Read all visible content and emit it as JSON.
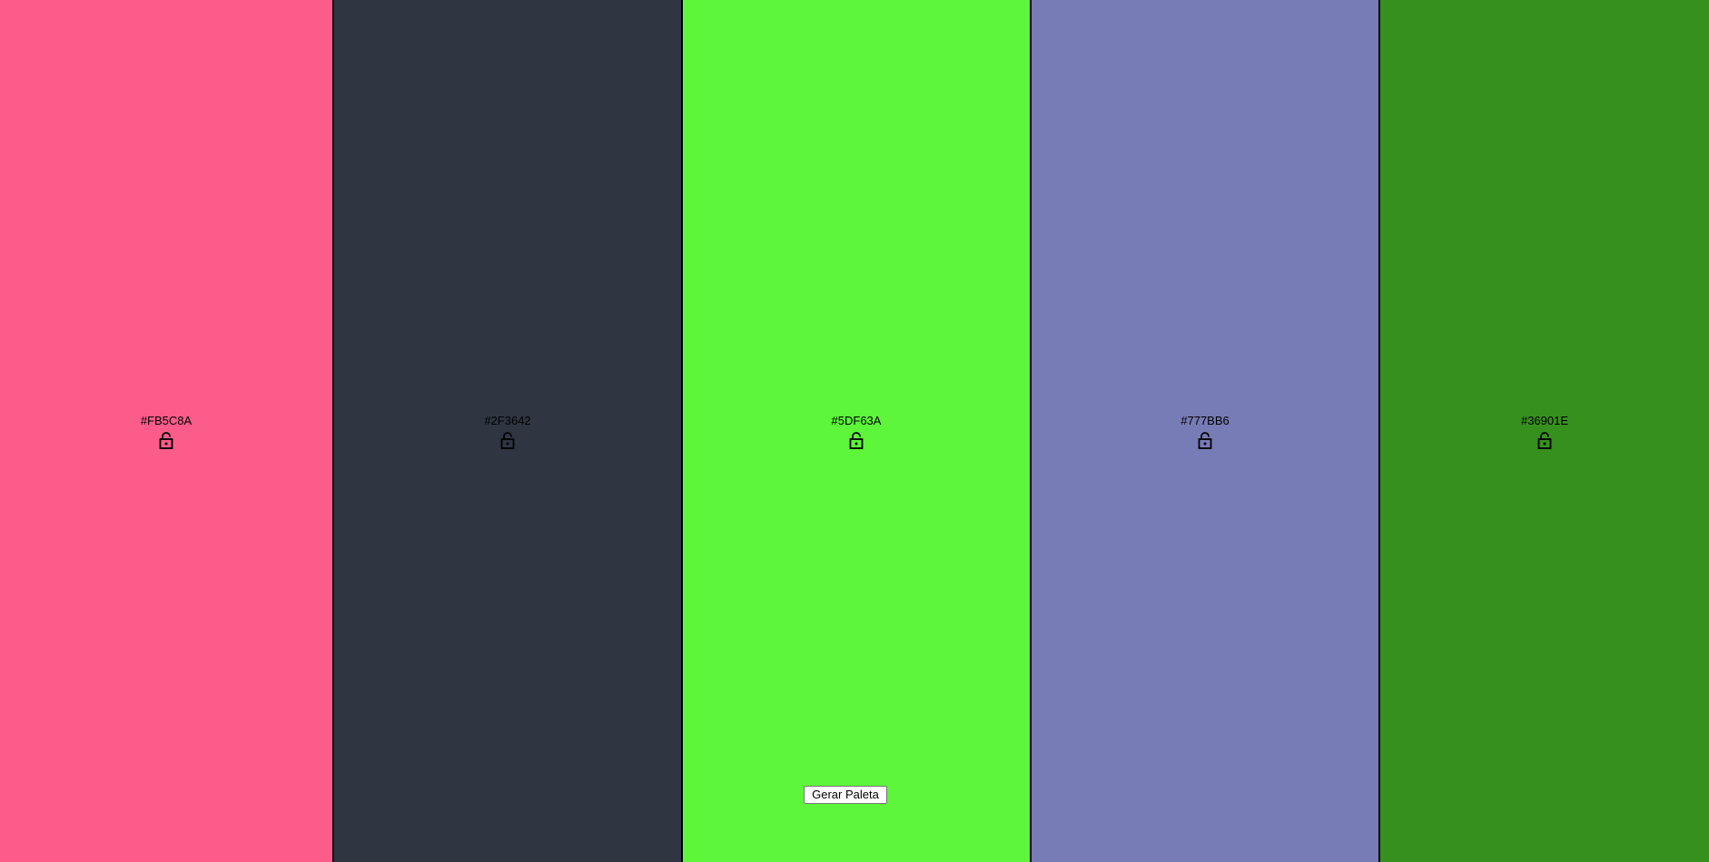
{
  "palette": {
    "swatches": [
      {
        "color": "#FB5C8A",
        "label": "#FB5C8A",
        "lock_icon": "unlocked-padlock-icon"
      },
      {
        "color": "#2F3642",
        "label": "#2F3642",
        "lock_icon": "unlocked-padlock-icon"
      },
      {
        "color": "#5DF63A",
        "label": "#5DF63A",
        "lock_icon": "unlocked-padlock-icon"
      },
      {
        "color": "#777BB6",
        "label": "#777BB6",
        "lock_icon": "unlocked-padlock-icon"
      },
      {
        "color": "#36901E",
        "label": "#36901E",
        "lock_icon": "unlocked-padlock-icon"
      }
    ]
  },
  "actions": {
    "generate_label": "Gerar Paleta"
  }
}
